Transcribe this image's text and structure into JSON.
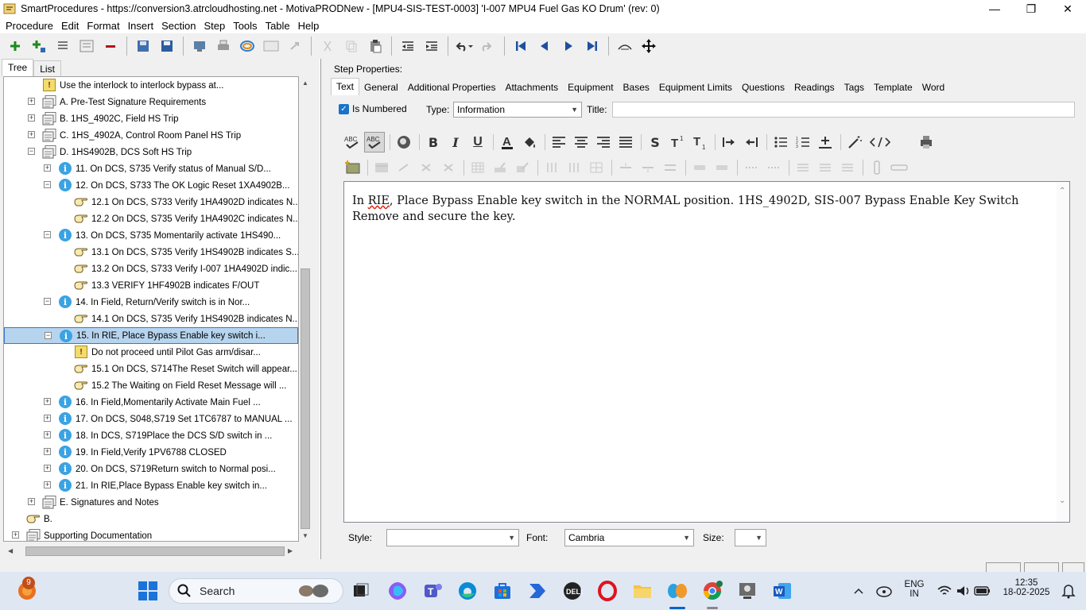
{
  "window": {
    "title": "SmartProcedures - https://conversion3.atrcloudhosting.net - MotivaPRODNew - [MPU4-SIS-TEST-0003] 'I-007 MPU4 Fuel Gas KO Drum' (rev: 0)"
  },
  "menu": [
    "Procedure",
    "Edit",
    "Format",
    "Insert",
    "Section",
    "Step",
    "Tools",
    "Table",
    "Help"
  ],
  "left_tabs": [
    "Tree",
    "List"
  ],
  "tree": [
    {
      "label": "Use the interlock to interlock bypass at...",
      "icon": "warning-icon",
      "exp": ""
    },
    {
      "label": "A. Pre-Test Signature Requirements",
      "icon": "section-icon",
      "exp": "+"
    },
    {
      "label": "B. 1HS_4902C, Field HS Trip",
      "icon": "section-icon",
      "exp": "+"
    },
    {
      "label": "C. 1HS_4902A, Control Room Panel HS Trip",
      "icon": "section-icon",
      "exp": "+"
    },
    {
      "label": "D. 1HS4902B, DCS Soft HS Trip",
      "icon": "section-icon",
      "exp": "−"
    },
    {
      "label": "11. On DCS, S735 Verify status of Manual S/D...",
      "icon": "info-icon",
      "exp": "+"
    },
    {
      "label": "12. On DCS, S733 The OK Logic Reset 1XA4902B...",
      "icon": "info-icon",
      "exp": "−"
    },
    {
      "label": "12.1 On DCS, S733 Verify 1HA4902D indicates N...",
      "icon": "hand-icon",
      "exp": ""
    },
    {
      "label": "12.2 On DCS, S735 Verify 1HA4902C indicates N...",
      "icon": "hand-icon",
      "exp": ""
    },
    {
      "label": "13. On DCS, S735 Momentarily activate 1HS490...",
      "icon": "info-icon",
      "exp": "−"
    },
    {
      "label": "13.1 On DCS, S735 Verify 1HS4902B indicates S...",
      "icon": "hand-icon",
      "exp": ""
    },
    {
      "label": "13.2 On DCS, S733 Verify I-007 1HA4902D indic...",
      "icon": "hand-icon",
      "exp": ""
    },
    {
      "label": "13.3 VERIFY 1HF4902B indicates F/OUT",
      "icon": "hand-icon",
      "exp": ""
    },
    {
      "label": "14. In Field, Return/Verify switch is in Nor...",
      "icon": "info-icon",
      "exp": "−"
    },
    {
      "label": "14.1 On DCS, S735 Verify 1HS4902B indicates N...",
      "icon": "hand-icon",
      "exp": ""
    },
    {
      "label": "15. In RIE, Place Bypass Enable key switch i...",
      "icon": "info-icon",
      "exp": "−",
      "selected": true
    },
    {
      "label": "Do not proceed until Pilot Gas arm/disar...",
      "icon": "warning-icon",
      "exp": ""
    },
    {
      "label": "15.1 On DCS, S714The Reset Switch will appear...",
      "icon": "hand-icon",
      "exp": ""
    },
    {
      "label": "15.2 The Waiting on Field Reset Message will ...",
      "icon": "hand-icon",
      "exp": ""
    },
    {
      "label": "16. In Field,Momentarily Activate Main Fuel ...",
      "icon": "info-icon",
      "exp": "+"
    },
    {
      "label": "17. On DCS, S048,S719 Set 1TC6787 to MANUAL ...",
      "icon": "info-icon",
      "exp": "+"
    },
    {
      "label": "18. In DCS, S719Place the DCS S/D switch in ...",
      "icon": "info-icon",
      "exp": "+"
    },
    {
      "label": "19. In Field,Verify 1PV6788 CLOSED",
      "icon": "info-icon",
      "exp": "+"
    },
    {
      "label": "20. On DCS, S719Return switch to Normal posi...",
      "icon": "info-icon",
      "exp": "+"
    },
    {
      "label": "21. In RIE,Place Bypass Enable key switch in...",
      "icon": "info-icon",
      "exp": "+"
    },
    {
      "label": "E. Signatures and Notes",
      "icon": "section-icon",
      "exp": "+"
    },
    {
      "label": "B.",
      "icon": "hand-icon",
      "exp": ""
    },
    {
      "label": "Supporting Documentation",
      "icon": "section-icon",
      "exp": "+"
    }
  ],
  "step_properties": {
    "heading": "Step Properties:",
    "tabs": [
      "Text",
      "General",
      "Additional Properties",
      "Attachments",
      "Equipment",
      "Bases",
      "Equipment Limits",
      "Questions",
      "Readings",
      "Tags",
      "Template",
      "Word"
    ],
    "is_numbered_label": "Is Numbered",
    "type_label": "Type:",
    "type_value": "Information",
    "title_label": "Title:",
    "title_value": "",
    "content_pre": "In ",
    "content_spell": "RIE",
    "content_post": ", Place Bypass Enable key switch in the NORMAL position. 1HS_4902D, SIS-007 Bypass Enable Key Switch   Remove and secure the key.",
    "style_label": "Style:",
    "style_value": "",
    "font_label": "Font:",
    "font_value": "Cambria",
    "size_label": "Size:",
    "size_value": ""
  },
  "taskbar": {
    "search_label": "Search",
    "notification_count": "9",
    "lang_top": "ENG",
    "lang_bottom": "IN",
    "time": "12:35",
    "date": "18-02-2025"
  },
  "colors": {
    "selection": "#b7d4ee",
    "info_icon": "#3aa3e3",
    "checkbox": "#1a73c9"
  }
}
